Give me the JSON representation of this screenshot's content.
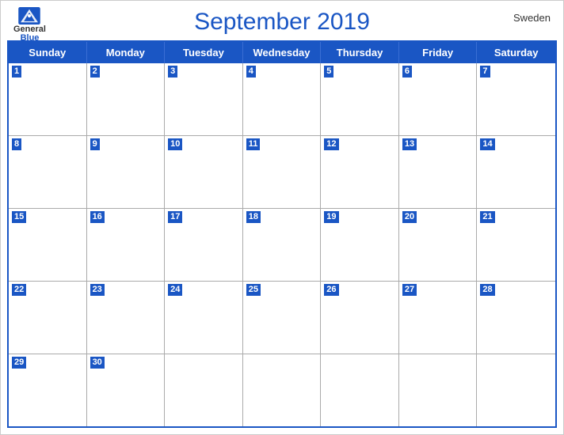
{
  "header": {
    "title": "September 2019",
    "country": "Sweden",
    "logo_general": "General",
    "logo_blue": "Blue"
  },
  "days_of_week": [
    "Sunday",
    "Monday",
    "Tuesday",
    "Wednesday",
    "Thursday",
    "Friday",
    "Saturday"
  ],
  "weeks": [
    [
      {
        "day": 1,
        "active": true
      },
      {
        "day": 2,
        "active": true
      },
      {
        "day": 3,
        "active": true
      },
      {
        "day": 4,
        "active": true
      },
      {
        "day": 5,
        "active": true
      },
      {
        "day": 6,
        "active": true
      },
      {
        "day": 7,
        "active": true
      }
    ],
    [
      {
        "day": 8,
        "active": true
      },
      {
        "day": 9,
        "active": true
      },
      {
        "day": 10,
        "active": true
      },
      {
        "day": 11,
        "active": true
      },
      {
        "day": 12,
        "active": true
      },
      {
        "day": 13,
        "active": true
      },
      {
        "day": 14,
        "active": true
      }
    ],
    [
      {
        "day": 15,
        "active": true
      },
      {
        "day": 16,
        "active": true
      },
      {
        "day": 17,
        "active": true
      },
      {
        "day": 18,
        "active": true
      },
      {
        "day": 19,
        "active": true
      },
      {
        "day": 20,
        "active": true
      },
      {
        "day": 21,
        "active": true
      }
    ],
    [
      {
        "day": 22,
        "active": true
      },
      {
        "day": 23,
        "active": true
      },
      {
        "day": 24,
        "active": true
      },
      {
        "day": 25,
        "active": true
      },
      {
        "day": 26,
        "active": true
      },
      {
        "day": 27,
        "active": true
      },
      {
        "day": 28,
        "active": true
      }
    ],
    [
      {
        "day": 29,
        "active": true
      },
      {
        "day": 30,
        "active": true
      },
      {
        "day": null,
        "active": false
      },
      {
        "day": null,
        "active": false
      },
      {
        "day": null,
        "active": false
      },
      {
        "day": null,
        "active": false
      },
      {
        "day": null,
        "active": false
      }
    ]
  ],
  "colors": {
    "header_blue": "#1a56c4",
    "border": "#aaa",
    "text_white": "#ffffff",
    "text_dark": "#333333"
  }
}
